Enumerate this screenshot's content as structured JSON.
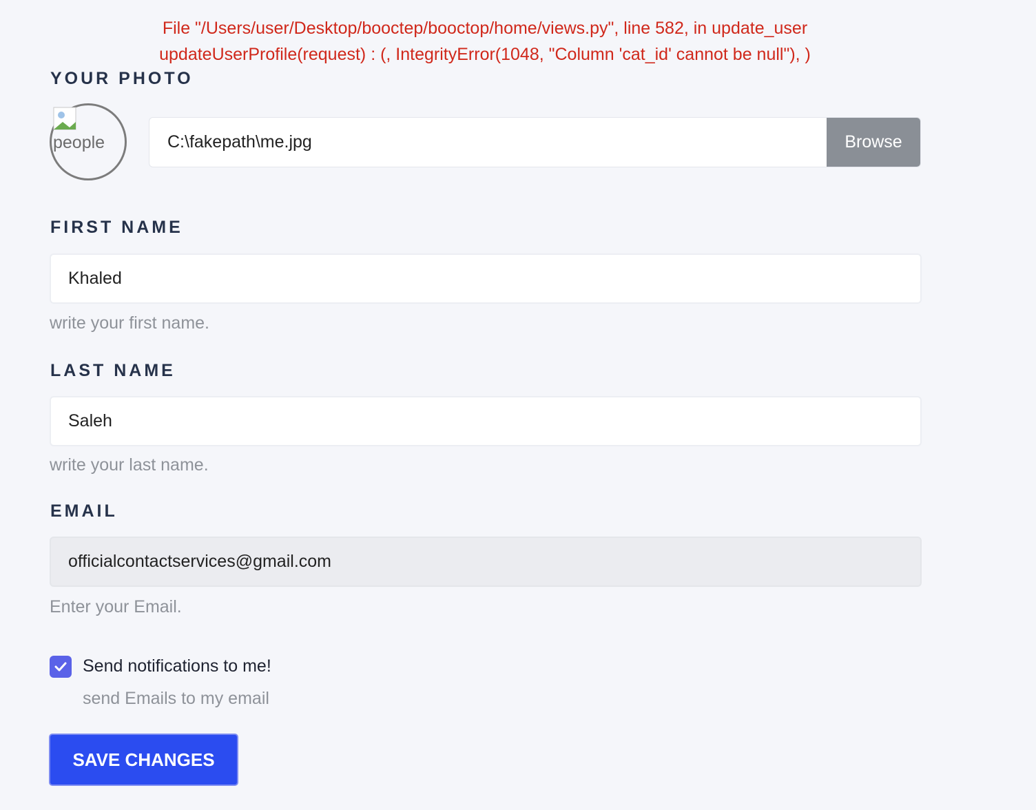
{
  "error": {
    "line1": "File \"/Users/user/Desktop/booctep/booctop/home/views.py\", line 582, in update_user",
    "line2": "updateUserProfile(request) : (, IntegrityError(1048, \"Column 'cat_id' cannot be null\"), )"
  },
  "photo": {
    "label": "YOUR PHOTO",
    "avatar_alt": "people",
    "file_value": "C:\\fakepath\\me.jpg",
    "browse_label": "Browse"
  },
  "first_name": {
    "label": "FIRST NAME",
    "value": "Khaled",
    "hint": "write your first name."
  },
  "last_name": {
    "label": "LAST NAME",
    "value": "Saleh",
    "hint": "write your last name."
  },
  "email": {
    "label": "EMAIL",
    "value": "officialcontactservices@gmail.com",
    "hint": "Enter your Email."
  },
  "notifications": {
    "checked": true,
    "label": "Send notifications to me!",
    "sublabel": "send Emails to my email"
  },
  "save_label": "SAVE CHANGES",
  "colors": {
    "error": "#d0281b",
    "checkbox": "#5a62e8",
    "primary_button": "#2b4cf0",
    "browse_button": "#8a8f96"
  }
}
